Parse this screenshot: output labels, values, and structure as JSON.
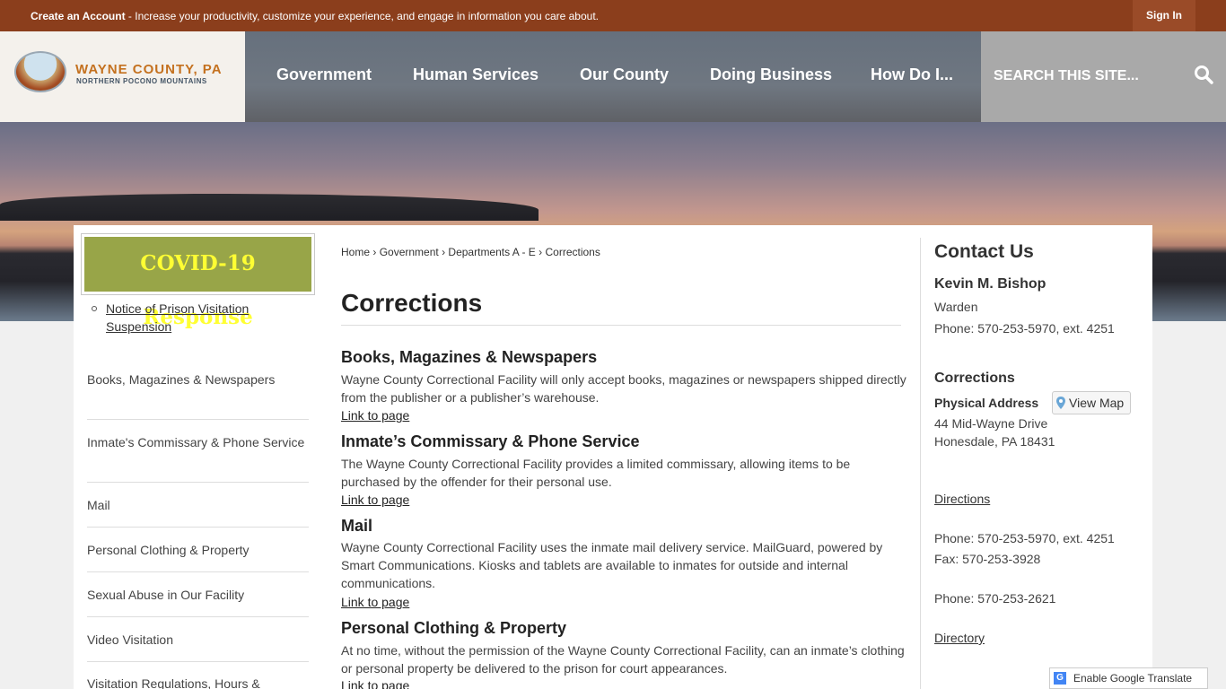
{
  "topbar": {
    "create_account": "Create an Account",
    "promo_text": " - Increase your productivity, customize your experience, and engage in information you care about.",
    "sign_in": "Sign In"
  },
  "header": {
    "logo_title": "WAYNE COUNTY, PA",
    "logo_subtitle": "NORTHERN POCONO MOUNTAINS",
    "nav": [
      "Government",
      "Human Services",
      "Our County",
      "Doing Business",
      "How Do I..."
    ],
    "search_placeholder": "SEARCH THIS SITE...",
    "search_icon": "search-icon"
  },
  "sidebar": {
    "covid_label": "COVID-19 Response",
    "notice": "Notice of Prison Visitation Suspension",
    "items": [
      "Books, Magazines & Newspapers",
      "Inmate's Commissary & Phone Service",
      "Mail",
      "Personal Clothing & Property",
      "Sexual Abuse in Our Facility",
      "Video Visitation",
      "Visitation Regulations, Hours &"
    ]
  },
  "breadcrumb": [
    "Home",
    "Government",
    "Departments A - E",
    "Corrections"
  ],
  "content": {
    "title": "Corrections",
    "link_label": "Link to page",
    "sections": [
      {
        "title": "Books, Magazines & Newspapers",
        "desc": "Wayne County Correctional Facility will only accept books, magazines or newspapers shipped directly from the publisher or a publisher’s warehouse."
      },
      {
        "title": "Inmate’s Commissary & Phone Service",
        "desc": "The Wayne County Correctional Facility provides a limited commissary, allowing items to be purchased by the offender for their personal use."
      },
      {
        "title": "Mail",
        "desc": "Wayne County Correctional Facility uses the inmate mail delivery service. MailGuard, powered by Smart Communications. Kiosks and tablets are available to inmates for outside and internal communications."
      },
      {
        "title": "Personal Clothing & Property",
        "desc": "At no time, without the permission of the Wayne County Correctional Facility, can an inmate’s clothing or personal property be delivered to the prison for court appearances."
      }
    ]
  },
  "contact": {
    "title": "Contact Us",
    "name": "Kevin M. Bishop",
    "role": "Warden",
    "phone1": "Phone: 570-253-5970, ext. 4251",
    "dept": "Corrections",
    "address_label": "Physical Address",
    "view_map": "View Map",
    "address1": "44 Mid-Wayne Drive",
    "address2": "Honesdale, PA 18431",
    "directions": "Directions",
    "phone2": "Phone: 570-253-5970, ext. 4251",
    "fax": "Fax: 570-253-3928",
    "phone3": "Phone: 570-253-2621",
    "directory": "Directory"
  },
  "translate": {
    "label": "Enable Google Translate"
  },
  "colors": {
    "topbar": "#8b3e1c",
    "nav": "#6f7781",
    "search": "#a9a9a9",
    "covid_bg": "#98a548",
    "covid_text": "#ffff33",
    "logo_accent": "#c4711f"
  }
}
